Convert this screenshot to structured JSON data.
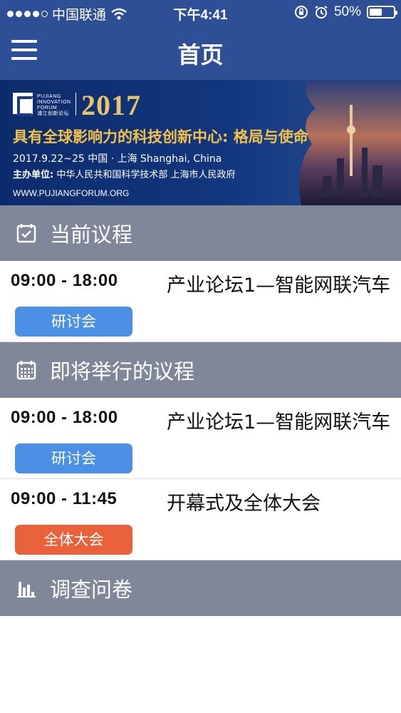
{
  "status_bar": {
    "carrier": "中国联通",
    "time": "下午4:41",
    "battery": "50%",
    "battery_level": 0.5
  },
  "nav": {
    "title": "首页"
  },
  "banner": {
    "logo_lines": [
      "PUJIANG",
      "INNOVATION",
      "FORUM",
      "浦江创新论坛"
    ],
    "year": "2017",
    "heading": "具有全球影响力的科技创新中心: 格局与使命",
    "date_line": "2017.9.22~25  中国 · 上海  Shanghai, China",
    "host_label": "主办单位:",
    "host_orgs": "中华人民共和国科学技术部     上海市人民政府",
    "url": "WWW.PUJIANGFORUM.ORG"
  },
  "sections": {
    "current": {
      "title": "当前议程",
      "icon": "calendar-check-icon"
    },
    "upcoming": {
      "title": "即将举行的议程",
      "icon": "calendar-grid-icon"
    },
    "survey": {
      "title": "调查问卷",
      "icon": "bar-chart-icon"
    }
  },
  "current_sessions": [
    {
      "time": "09:00 - 18:00",
      "title": "产业论坛1—智能网联汽车",
      "tag": "研讨会",
      "tag_color": "#4b90e5"
    }
  ],
  "upcoming_sessions": [
    {
      "time": "09:00 - 18:00",
      "title": "产业论坛1—智能网联汽车",
      "tag": "研讨会",
      "tag_color": "#4b90e5"
    },
    {
      "time": "09:00 - 11:45",
      "title": "开幕式及全体大会",
      "tag": "全体大会",
      "tag_color": "#e9623c"
    }
  ],
  "colors": {
    "header_blue": "#2e4f96",
    "section_gray": "#7f8799",
    "tag_blue": "#4b90e5",
    "tag_orange": "#e9623c",
    "banner_gold": "#f2c24a"
  }
}
